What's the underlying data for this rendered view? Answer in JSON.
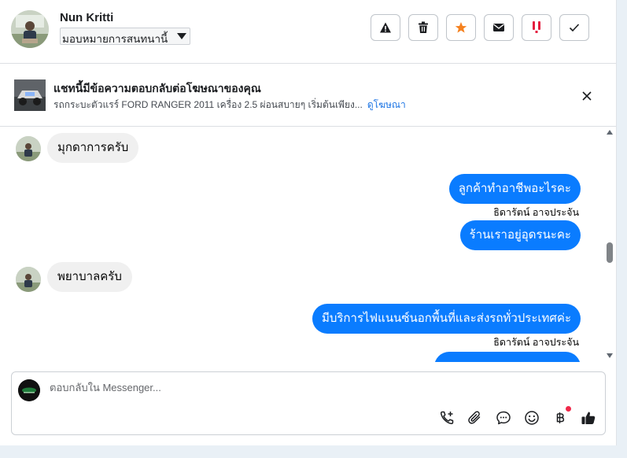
{
  "header": {
    "contact_name": "Nun Kritti",
    "assign_label": "มอบหมายการสนทนานี้",
    "toolbar": [
      {
        "name": "report-spam-button",
        "icon": "warning-icon"
      },
      {
        "name": "delete-button",
        "icon": "trash-icon"
      },
      {
        "name": "star-button",
        "icon": "star-icon",
        "color": "#f5811f"
      },
      {
        "name": "mark-unread-button",
        "icon": "envelope-icon"
      },
      {
        "name": "follow-up-button",
        "icon": "flag-icon",
        "color": "#e41e3f"
      },
      {
        "name": "mark-done-button",
        "icon": "check-icon"
      }
    ]
  },
  "ad_banner": {
    "title": "แชทนี้มีข้อความตอบกลับต่อโฆษณาของคุณ",
    "description": "รถกระบะตัวแรร์ FORD RANGER 2011 เครื่อง 2.5 ผ่อนสบายๆ เริ่มต้นเพียง...",
    "link_label": "ดูโฆษณา"
  },
  "messages": [
    {
      "direction": "in",
      "text": "มุกดาการครับ"
    },
    {
      "direction": "out",
      "text": "ลูกค้าทำอาชีพอะไรคะ",
      "sender": "ธิดารัตน์ อาจประจัน"
    },
    {
      "direction": "out",
      "text": "ร้านเราอยู่อุดรนะคะ"
    },
    {
      "direction": "in",
      "text": "พยาบาลครับ"
    },
    {
      "direction": "out",
      "text": "มีบริการไฟแนนซ์นอกพื้นที่และส่งรถทั่วประเทศค่ะ",
      "sender": "ธิดารัตน์ อาจประจัน"
    }
  ],
  "composer": {
    "placeholder": "ตอบกลับใน Messenger...",
    "icons": [
      "phone-plus-icon",
      "paperclip-icon",
      "chat-bubble-icon",
      "emoji-icon",
      "baht-icon",
      "thumbs-up-icon"
    ]
  },
  "colors": {
    "outgoing_bubble": "#0a7cff",
    "incoming_bubble": "#f0f0f0",
    "link": "#1b74e4"
  }
}
